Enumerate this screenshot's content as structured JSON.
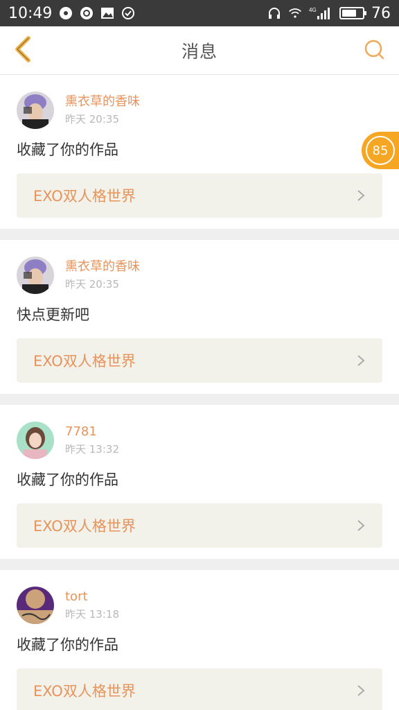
{
  "status_bar": {
    "time": "10:49",
    "battery": "76",
    "battery_level": 0.76,
    "network": "4G",
    "left_icons": [
      "settings-icon",
      "sync-icon",
      "image-icon",
      "check-circle-icon"
    ],
    "right_icons": [
      "headphones-icon",
      "wifi-icon",
      "signal-icon",
      "battery-icon"
    ]
  },
  "header": {
    "title": "消息",
    "back_icon": "chevron-left-icon",
    "search_icon": "search-icon"
  },
  "float_badge": {
    "value": "85"
  },
  "messages": [
    {
      "username": "熏衣草的香味",
      "time": "昨天 20:35",
      "text": "收藏了你的作品",
      "work_title": "EXO双人格世界",
      "avatar": "purple-hair-avatar"
    },
    {
      "username": "熏衣草的香味",
      "time": "昨天 20:35",
      "text": "快点更新吧",
      "work_title": "EXO双人格世界",
      "avatar": "purple-hair-avatar"
    },
    {
      "username": "7781",
      "time": "昨天 13:32",
      "text": "收藏了你的作品",
      "work_title": "EXO双人格世界",
      "avatar": "girl-avatar"
    },
    {
      "username": "tort",
      "time": "昨天 13:18",
      "text": "收藏了你的作品",
      "work_title": "EXO双人格世界",
      "avatar": "purple-graphic-avatar"
    }
  ],
  "colors": {
    "accent": "#e8935a",
    "badge": "#f5a623",
    "link_bg": "#f2f1ea",
    "back_icon": "#f0b44a"
  }
}
